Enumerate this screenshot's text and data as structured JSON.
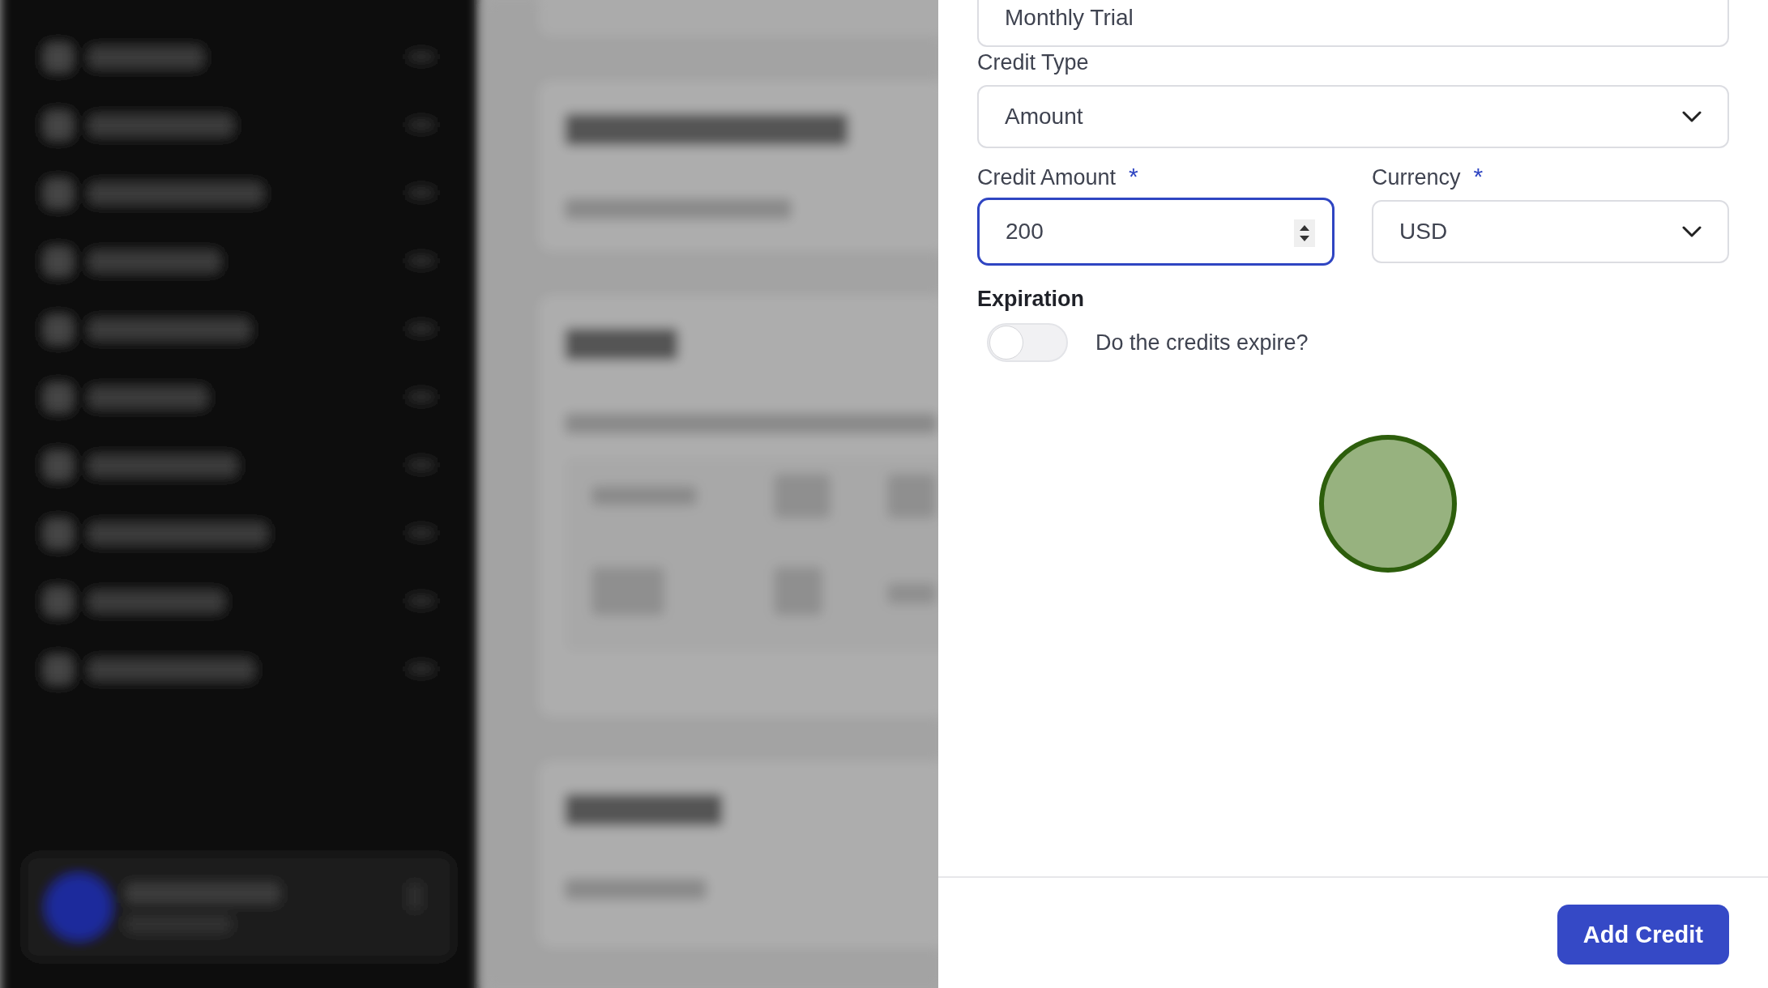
{
  "drawer": {
    "name_field": {
      "value": "Monthly Trial"
    },
    "credit_type": {
      "label": "Credit Type",
      "value": "Amount"
    },
    "credit_amount": {
      "label": "Credit Amount",
      "required_mark": "*",
      "value": "200",
      "focused": true
    },
    "currency": {
      "label": "Currency",
      "required_mark": "*",
      "value": "USD"
    },
    "expiration": {
      "label": "Expiration",
      "toggle": {
        "label": "Do the credits expire?",
        "on": false
      }
    },
    "footer": {
      "button": "Add Credit"
    }
  }
}
